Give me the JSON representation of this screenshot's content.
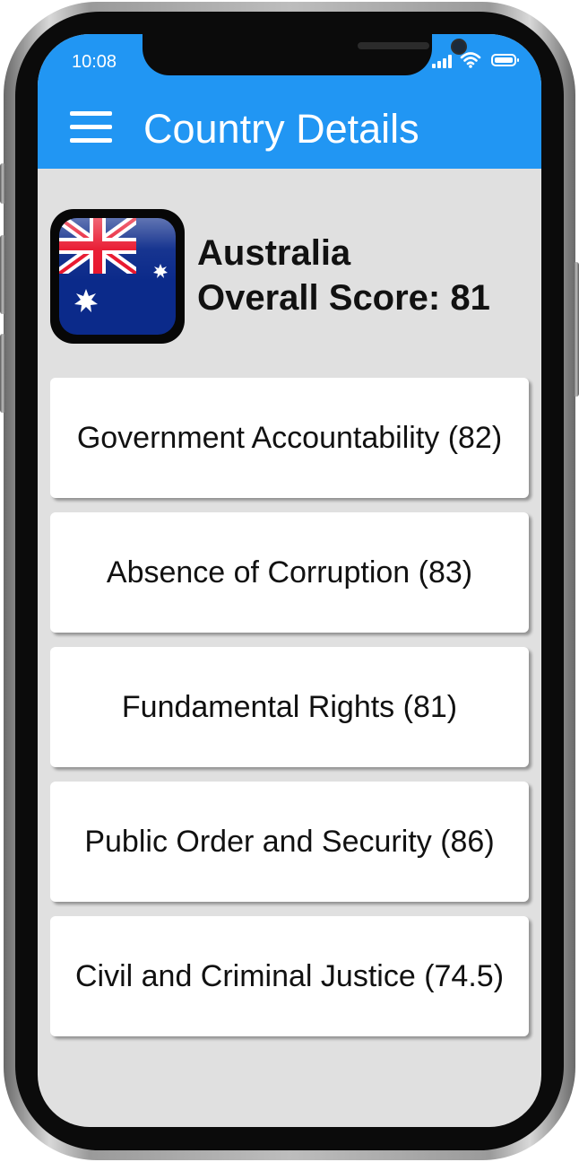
{
  "status_bar": {
    "time": "10:08"
  },
  "app_bar": {
    "title": "Country Details",
    "menu_icon": "hamburger-menu-icon"
  },
  "country": {
    "name": "Australia",
    "overall_score_text": "Overall Score: 81",
    "flag_icon": "australia-flag-icon",
    "flag_colors": {
      "blue": "#0b2a8a",
      "red": "#e8142b",
      "white": "#ffffff"
    }
  },
  "categories": [
    {
      "label": "Government Accountability (82)"
    },
    {
      "label": "Absence of Corruption (83)"
    },
    {
      "label": "Fundamental Rights (81)"
    },
    {
      "label": "Public Order and Security (86)"
    },
    {
      "label": "Civil and Criminal Justice (74.5)"
    }
  ],
  "colors": {
    "app_bar": "#2196f3",
    "background": "#e0e0e0",
    "card": "#ffffff"
  }
}
